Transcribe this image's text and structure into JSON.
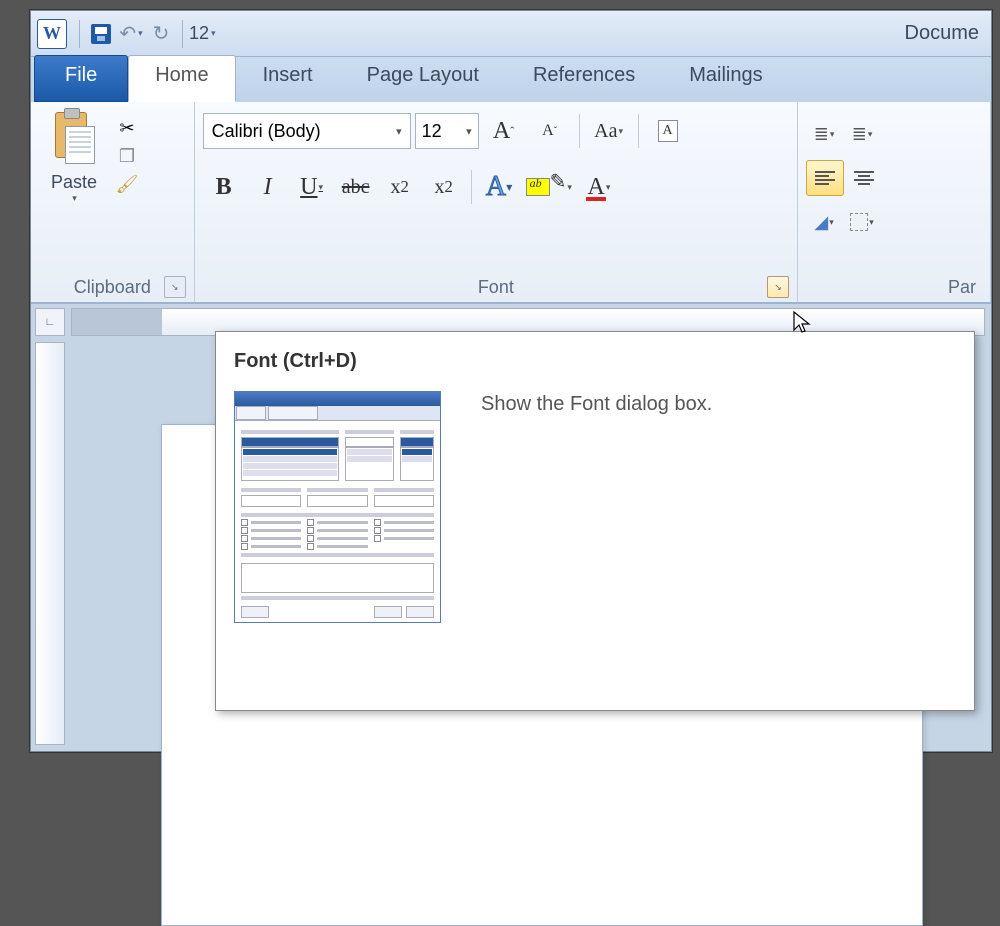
{
  "title": "Docume",
  "tabs": {
    "file": "File",
    "home": "Home",
    "insert": "Insert",
    "pageLayout": "Page Layout",
    "references": "References",
    "mailings": "Mailings"
  },
  "qat": {
    "fontSizePreset": "12"
  },
  "clipboard": {
    "paste": "Paste",
    "groupLabel": "Clipboard"
  },
  "font": {
    "groupLabel": "Font",
    "fontName": "Calibri (Body)",
    "fontSize": "12",
    "bold": "B",
    "italic": "I",
    "underline": "U",
    "strike": "abc",
    "subscript": "x",
    "subscriptIdx": "2",
    "superscript": "x",
    "superscriptIdx": "2",
    "growA": "A",
    "shrinkA": "A",
    "caseAa": "Aa",
    "outlineA": "A",
    "fontColorA": "A",
    "highlight": "ab"
  },
  "paragraph": {
    "groupLabel": "Par"
  },
  "tooltip": {
    "title": "Font (Ctrl+D)",
    "desc": "Show the Font dialog box."
  }
}
